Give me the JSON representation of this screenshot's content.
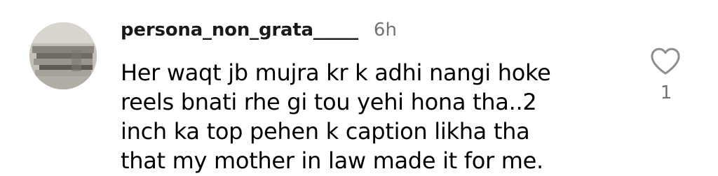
{
  "comment": {
    "username": "persona_non_grata_____",
    "timestamp": "6h",
    "text_lines": [
      "Her waqt jb mujra kr k adhi nangi hoke",
      "reels bnati rhe gi tou yehi hona tha..2",
      "inch ka top pehen k caption likha tha",
      "that my mother in law made it for me."
    ],
    "like_icon": "heart-outline-icon",
    "like_count": "1",
    "avatar": "profile-photo-avatar"
  },
  "colors": {
    "background": "#ffffff",
    "text": "#000000",
    "secondary_text": "#737373",
    "icon": "#8e8e8e"
  }
}
